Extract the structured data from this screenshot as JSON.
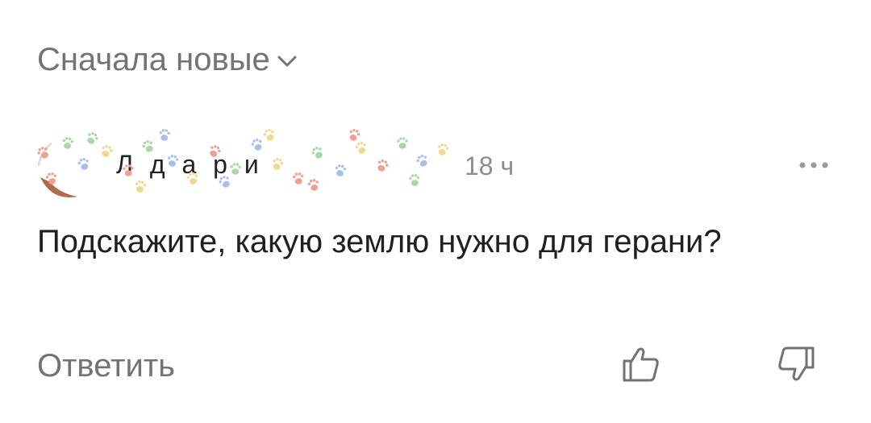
{
  "sort": {
    "label": "Сначала новые",
    "icon": "chevron-down-icon"
  },
  "comment": {
    "author": "Л  д    а    р   и",
    "time": "18 ч",
    "text": "Подскажите, какую землю нужно для герани?",
    "more_icon": "more-dots-icon"
  },
  "actions": {
    "reply_label": "Ответить",
    "like_icon": "thumbs-up-icon",
    "dislike_icon": "thumbs-down-icon"
  },
  "colors": {
    "secondary_text": "#737373",
    "timestamp": "#8c8c8c",
    "paw_colors": [
      "#f0a090",
      "#a8d8a8",
      "#a8c0e8",
      "#f0d890"
    ]
  }
}
